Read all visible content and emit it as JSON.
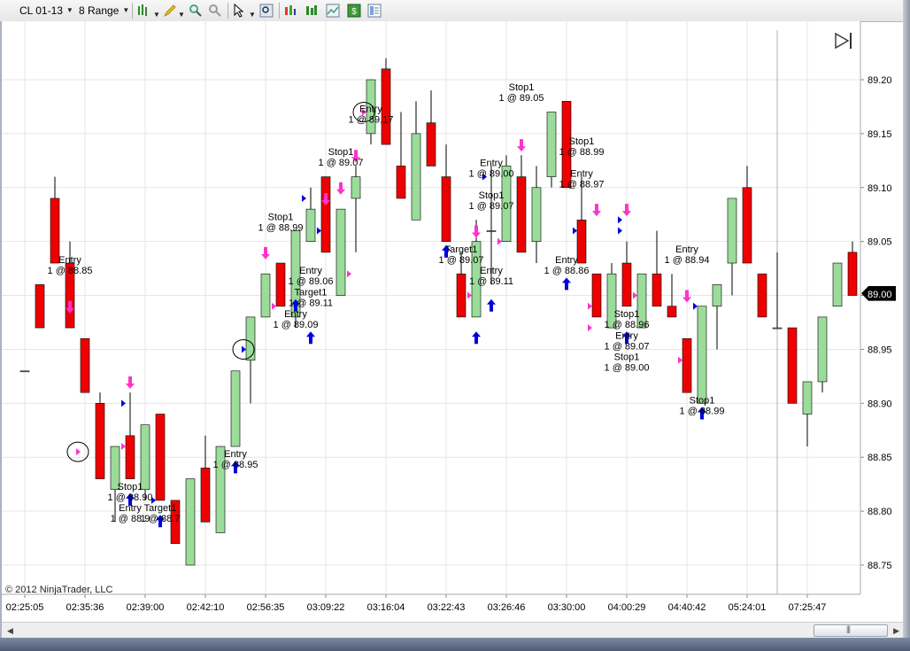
{
  "toolbar": {
    "instrument": "CL 01-13",
    "period": "8 Range",
    "icons": [
      "bars-icon",
      "pencil-icon",
      "zoom-in-icon",
      "zoom-out-icon",
      "pointer-icon",
      "magnifier-icon",
      "strategy-icon",
      "indicators-icon",
      "chart-trader-icon",
      "money-icon",
      "properties-icon"
    ]
  },
  "copyright": "© 2012 NinjaTrader, LLC",
  "colors": {
    "up": "#9bdc9b",
    "down": "#ee0000",
    "buyArrow": "#0000dd",
    "sellArrow": "#ff33cc",
    "grid": "#e6e6e6"
  },
  "chart_data": {
    "type": "candlestick",
    "ylim": [
      88.72,
      89.25
    ],
    "price_ticks": [
      "89.20",
      "89.15",
      "89.10",
      "89.05",
      "89.00",
      "88.95",
      "88.90",
      "88.85",
      "88.80",
      "88.75"
    ],
    "current_price": "89.00",
    "time_labels": [
      "02:25:05",
      "02:35:36",
      "02:39:00",
      "02:42:10",
      "02:56:35",
      "03:09:22",
      "03:16:04",
      "03:22:43",
      "03:26:46",
      "03:30:00",
      "04:00:29",
      "04:40:42",
      "05:24:01",
      "07:25:47"
    ],
    "bars": [
      [
        88.93,
        89.01,
        89.01,
        88.93
      ],
      [
        89.01,
        89.05,
        89.05,
        88.97
      ],
      [
        89.09,
        89.11,
        89.08,
        89.03
      ],
      [
        89.03,
        89.05,
        88.97,
        88.97
      ],
      [
        88.96,
        88.96,
        88.91,
        88.91
      ],
      [
        88.9,
        88.91,
        88.83,
        88.83
      ],
      [
        88.82,
        88.86,
        88.79,
        88.86
      ],
      [
        88.87,
        88.91,
        88.83,
        88.83
      ],
      [
        88.82,
        88.88,
        88.81,
        88.88
      ],
      [
        88.89,
        88.89,
        88.81,
        88.81
      ],
      [
        88.81,
        88.81,
        88.77,
        88.77
      ],
      [
        88.75,
        88.83,
        88.75,
        88.83
      ],
      [
        88.84,
        88.87,
        88.79,
        88.79
      ],
      [
        88.78,
        88.86,
        88.78,
        88.86
      ],
      [
        88.86,
        88.93,
        88.86,
        88.93
      ],
      [
        88.94,
        88.98,
        88.9,
        88.98
      ],
      [
        88.98,
        89.02,
        88.98,
        89.02
      ],
      [
        89.03,
        89.03,
        88.99,
        88.99
      ],
      [
        88.98,
        89.06,
        88.97,
        89.06
      ],
      [
        89.05,
        89.1,
        89.05,
        89.08
      ],
      [
        89.11,
        89.11,
        89.04,
        89.04
      ],
      [
        89.0,
        89.08,
        89.0,
        89.08
      ],
      [
        89.09,
        89.12,
        89.04,
        89.11
      ],
      [
        89.15,
        89.2,
        89.14,
        89.2
      ],
      [
        89.21,
        89.22,
        89.14,
        89.14
      ],
      [
        89.12,
        89.17,
        89.09,
        89.09
      ],
      [
        89.07,
        89.18,
        89.07,
        89.15
      ],
      [
        89.16,
        89.19,
        89.12,
        89.12
      ],
      [
        89.11,
        89.14,
        89.05,
        89.05
      ],
      [
        89.02,
        89.04,
        88.98,
        88.98
      ],
      [
        88.98,
        89.07,
        88.98,
        89.05
      ],
      [
        89.06,
        89.12,
        89.01,
        89.06
      ],
      [
        89.05,
        89.13,
        89.05,
        89.12
      ],
      [
        89.11,
        89.13,
        89.04,
        89.04
      ],
      [
        89.05,
        89.12,
        89.03,
        89.1
      ],
      [
        89.11,
        89.17,
        89.1,
        89.17
      ],
      [
        89.18,
        89.18,
        89.1,
        89.1
      ],
      [
        89.07,
        89.11,
        89.03,
        89.03
      ],
      [
        89.02,
        89.02,
        88.98,
        88.98
      ],
      [
        88.97,
        89.03,
        88.97,
        89.02
      ],
      [
        89.03,
        89.05,
        88.99,
        88.99
      ],
      [
        88.97,
        89.02,
        88.97,
        89.02
      ],
      [
        89.02,
        89.06,
        88.99,
        88.99
      ],
      [
        88.99,
        89.02,
        88.98,
        88.98
      ],
      [
        88.96,
        88.96,
        88.91,
        88.91
      ],
      [
        88.9,
        88.99,
        88.9,
        88.99
      ],
      [
        88.99,
        89.01,
        88.95,
        89.01
      ],
      [
        89.03,
        89.09,
        89.0,
        89.09
      ],
      [
        89.1,
        89.12,
        89.03,
        89.03
      ],
      [
        89.02,
        89.02,
        88.98,
        88.98
      ],
      [
        88.97,
        89.04,
        88.97,
        88.97
      ],
      [
        88.97,
        88.97,
        88.9,
        88.9
      ],
      [
        88.89,
        88.92,
        88.86,
        88.92
      ],
      [
        88.92,
        88.98,
        88.91,
        88.98
      ],
      [
        88.99,
        89.03,
        88.99,
        89.03
      ],
      [
        89.04,
        89.05,
        89.0,
        89.0
      ]
    ],
    "labels": [
      {
        "bar": 3,
        "side": "above",
        "price": 89.03,
        "lines": [
          "Entry",
          "1 @ 88.85"
        ]
      },
      {
        "bar": 7,
        "side": "below",
        "price": 88.82,
        "lines": [
          "Stop1",
          "1 @ 88.90"
        ]
      },
      {
        "bar": 7,
        "side": "below",
        "price": 88.8,
        "lines": [
          "Entry",
          "1 @ 88.9"
        ]
      },
      {
        "bar": 9,
        "side": "below",
        "price": 88.8,
        "lines": [
          "Target1",
          "1 @ 88.7"
        ]
      },
      {
        "bar": 14,
        "side": "below",
        "price": 88.85,
        "lines": [
          "Entry",
          "1 @ 88.95"
        ]
      },
      {
        "bar": 17,
        "side": "above",
        "price": 89.07,
        "lines": [
          "Stop1",
          "1 @ 88.99"
        ]
      },
      {
        "bar": 19,
        "side": "below",
        "price": 89.02,
        "lines": [
          "Entry",
          "1 @ 89.06"
        ]
      },
      {
        "bar": 19,
        "side": "below",
        "price": 89.0,
        "lines": [
          "Target1",
          "1 @ 89.11"
        ]
      },
      {
        "bar": 18,
        "side": "below",
        "price": 88.98,
        "lines": [
          "Entry",
          "1 @ 89.09"
        ]
      },
      {
        "bar": 21,
        "side": "above",
        "price": 89.13,
        "lines": [
          "Stop1",
          "1 @ 89.07"
        ]
      },
      {
        "bar": 23,
        "side": "above",
        "price": 89.17,
        "lines": [
          "Entry",
          "1 @ 89.17"
        ]
      },
      {
        "bar": 29,
        "side": "below",
        "price": 89.04,
        "lines": [
          "Target1",
          "1 @ 89.07"
        ]
      },
      {
        "bar": 31,
        "side": "above",
        "price": 89.12,
        "lines": [
          "Entry",
          "1 @ 89.00"
        ]
      },
      {
        "bar": 31,
        "side": "above",
        "price": 89.09,
        "lines": [
          "Stop1",
          "1 @ 89.07"
        ]
      },
      {
        "bar": 31,
        "side": "below",
        "price": 89.02,
        "lines": [
          "Entry",
          "1 @ 89.11"
        ]
      },
      {
        "bar": 33,
        "side": "above",
        "price": 89.19,
        "lines": [
          "Stop1",
          "1 @ 89.05"
        ]
      },
      {
        "bar": 37,
        "side": "above",
        "price": 89.14,
        "lines": [
          "Stop1",
          "1 @ 88.99"
        ]
      },
      {
        "bar": 37,
        "side": "above",
        "price": 89.11,
        "lines": [
          "Entry",
          "1 @ 88.97"
        ]
      },
      {
        "bar": 36,
        "side": "below",
        "price": 89.03,
        "lines": [
          "Entry",
          "1 @ 88.86"
        ]
      },
      {
        "bar": 40,
        "side": "below",
        "price": 88.98,
        "lines": [
          "Stop1",
          "1 @ 88.96"
        ]
      },
      {
        "bar": 40,
        "side": "below",
        "price": 88.96,
        "lines": [
          "Entry",
          "1 @ 89.07"
        ]
      },
      {
        "bar": 40,
        "side": "below",
        "price": 88.94,
        "lines": [
          "Stop1",
          "1 @ 89.00"
        ]
      },
      {
        "bar": 44,
        "side": "above",
        "price": 89.04,
        "lines": [
          "Entry",
          "1 @ 88.94"
        ]
      },
      {
        "bar": 45,
        "side": "below",
        "price": 88.9,
        "lines": [
          "Stop1",
          "1 @ 88.99"
        ]
      }
    ],
    "arrows": [
      {
        "bar": 3,
        "dir": "down",
        "price": 88.99
      },
      {
        "bar": 7,
        "dir": "up",
        "price": 88.81
      },
      {
        "bar": 7,
        "dir": "down",
        "price": 88.92
      },
      {
        "bar": 9,
        "dir": "up",
        "price": 88.79
      },
      {
        "bar": 14,
        "dir": "up",
        "price": 88.84
      },
      {
        "bar": 16,
        "dir": "down",
        "price": 89.04
      },
      {
        "bar": 18,
        "dir": "up",
        "price": 88.99
      },
      {
        "bar": 19,
        "dir": "up",
        "price": 88.96
      },
      {
        "bar": 20,
        "dir": "down",
        "price": 89.09
      },
      {
        "bar": 21,
        "dir": "down",
        "price": 89.1
      },
      {
        "bar": 22,
        "dir": "down",
        "price": 89.13
      },
      {
        "bar": 28,
        "dir": "up",
        "price": 89.04
      },
      {
        "bar": 30,
        "dir": "down",
        "price": 89.06
      },
      {
        "bar": 30,
        "dir": "up",
        "price": 88.96
      },
      {
        "bar": 31,
        "dir": "up",
        "price": 88.99
      },
      {
        "bar": 33,
        "dir": "down",
        "price": 89.14
      },
      {
        "bar": 36,
        "dir": "up",
        "price": 89.01
      },
      {
        "bar": 38,
        "dir": "down",
        "price": 89.08
      },
      {
        "bar": 40,
        "dir": "up",
        "price": 88.96
      },
      {
        "bar": 40,
        "dir": "down",
        "price": 89.08
      },
      {
        "bar": 44,
        "dir": "down",
        "price": 89.0
      },
      {
        "bar": 45,
        "dir": "up",
        "price": 88.89
      }
    ],
    "triangles": [
      {
        "bar": 4,
        "color": "sellArrow",
        "price": 88.855,
        "circled": true
      },
      {
        "bar": 7,
        "color": "sellArrow",
        "price": 88.86
      },
      {
        "bar": 7,
        "color": "buyArrow",
        "price": 88.9
      },
      {
        "bar": 9,
        "color": "buyArrow",
        "price": 88.81
      },
      {
        "bar": 15,
        "color": "buyArrow",
        "price": 88.95,
        "circled": true
      },
      {
        "bar": 17,
        "color": "sellArrow",
        "price": 88.99
      },
      {
        "bar": 19,
        "color": "buyArrow",
        "price": 89.09
      },
      {
        "bar": 20,
        "color": "buyArrow",
        "price": 89.06
      },
      {
        "bar": 22,
        "color": "sellArrow",
        "price": 89.02
      },
      {
        "bar": 23,
        "color": "sellArrow",
        "price": 89.17,
        "circled": true
      },
      {
        "bar": 30,
        "color": "sellArrow",
        "price": 89.0
      },
      {
        "bar": 31,
        "color": "buyArrow",
        "price": 89.11
      },
      {
        "bar": 32,
        "color": "sellArrow",
        "price": 89.05
      },
      {
        "bar": 37,
        "color": "buyArrow",
        "price": 89.06
      },
      {
        "bar": 38,
        "color": "sellArrow",
        "price": 88.99
      },
      {
        "bar": 38,
        "color": "sellArrow",
        "price": 88.97
      },
      {
        "bar": 40,
        "color": "buyArrow",
        "price": 89.07
      },
      {
        "bar": 40,
        "color": "buyArrow",
        "price": 89.06
      },
      {
        "bar": 41,
        "color": "sellArrow",
        "price": 89.0
      },
      {
        "bar": 44,
        "color": "sellArrow",
        "price": 88.94
      },
      {
        "bar": 45,
        "color": "buyArrow",
        "price": 88.99
      }
    ]
  }
}
